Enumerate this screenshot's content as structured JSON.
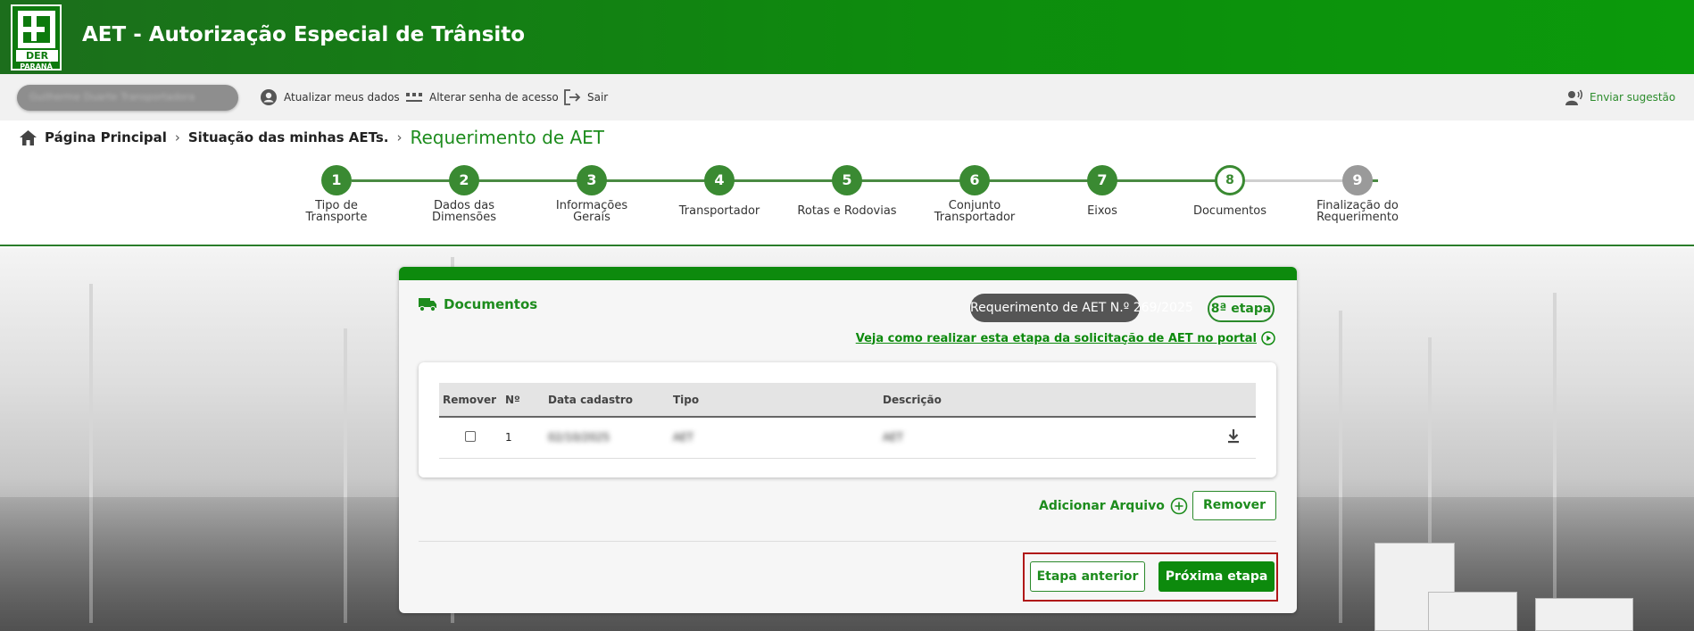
{
  "header": {
    "app_title": "AET - Autorização Especial de Trânsito",
    "logo_text": "DER",
    "logo_subtext": "PARANÁ"
  },
  "userbar": {
    "user_name": "Guilherme Duarte Transportadora",
    "update_data": "Atualizar meus dados",
    "change_password": "Alterar senha de acesso",
    "logout": "Sair",
    "suggestion": "Enviar sugestão"
  },
  "breadcrumb": {
    "home": "Página Principal",
    "status": "Situação das minhas AETs.",
    "current": "Requerimento de AET"
  },
  "stepper": {
    "steps": [
      {
        "num": "1",
        "label": "Tipo de Transporte",
        "state": "done"
      },
      {
        "num": "2",
        "label": "Dados das Dimensões",
        "state": "done"
      },
      {
        "num": "3",
        "label": "Informações Gerais",
        "state": "done"
      },
      {
        "num": "4",
        "label": "Transportador",
        "state": "done"
      },
      {
        "num": "5",
        "label": "Rotas e Rodovias",
        "state": "done"
      },
      {
        "num": "6",
        "label": "Conjunto Transportador",
        "state": "done"
      },
      {
        "num": "7",
        "label": "Eixos",
        "state": "done"
      },
      {
        "num": "8",
        "label": "Documentos",
        "state": "current"
      },
      {
        "num": "9",
        "label": "Finalização do Requerimento",
        "state": "pending"
      }
    ]
  },
  "card": {
    "title": "Documentos",
    "request_badge": "Requerimento de AET N.º 269/2025",
    "stage_badge": "8ª etapa",
    "help_link": "Veja como realizar esta etapa da solicitação de AET no portal",
    "table": {
      "headers": [
        "Remover",
        "Nº",
        "Data cadastro",
        "Tipo",
        "Descrição"
      ],
      "rows": [
        {
          "num": "1",
          "date": "02/10/2025",
          "type": "AET",
          "description": "AET"
        }
      ]
    },
    "add_file": "Adicionar Arquivo",
    "remove_button": "Remover",
    "prev_button": "Etapa anterior",
    "next_button": "Próxima etapa"
  },
  "colors": {
    "primary_green": "#0d8a0d",
    "step_green": "#3a8a32",
    "pending_gray": "#9a9a9a",
    "highlight_red": "#b01818"
  }
}
